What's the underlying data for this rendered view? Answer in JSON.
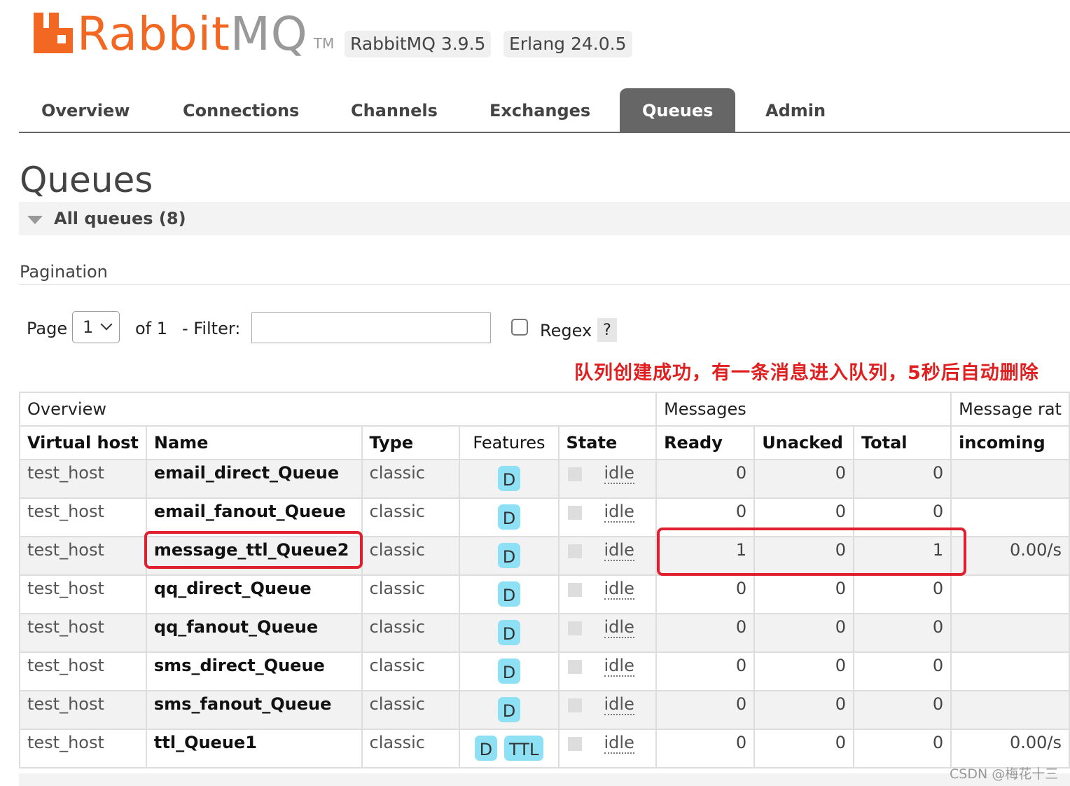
{
  "header": {
    "logo_brand": "Rabbit",
    "logo_suffix": "MQ",
    "logo_tm": "TM",
    "rabbitmq_version": "RabbitMQ 3.9.5",
    "erlang_version": "Erlang 24.0.5",
    "brand_color": "#f26822"
  },
  "nav": {
    "tabs": [
      "Overview",
      "Connections",
      "Channels",
      "Exchanges",
      "Queues",
      "Admin"
    ],
    "active": "Queues"
  },
  "page_title": "Queues",
  "section_label": "All queues (8)",
  "pagination": {
    "title": "Pagination",
    "page_label": "Page",
    "page_value": "1",
    "of_label": "of 1",
    "filter_label": "- Filter:",
    "filter_value": "",
    "regex_label": "Regex",
    "help_label": "?"
  },
  "annotation": "队列创建成功，有一条消息进入队列，5秒后自动删除",
  "table": {
    "groups": [
      "Overview",
      "Messages",
      "Message rat"
    ],
    "columns": [
      "Virtual host",
      "Name",
      "Type",
      "Features",
      "State",
      "Ready",
      "Unacked",
      "Total",
      "incoming"
    ],
    "rows": [
      {
        "vhost": "test_host",
        "name": "email_direct_Queue",
        "type": "classic",
        "features": [
          "D"
        ],
        "state": "idle",
        "ready": "0",
        "unacked": "0",
        "total": "0",
        "incoming": ""
      },
      {
        "vhost": "test_host",
        "name": "email_fanout_Queue",
        "type": "classic",
        "features": [
          "D"
        ],
        "state": "idle",
        "ready": "0",
        "unacked": "0",
        "total": "0",
        "incoming": ""
      },
      {
        "vhost": "test_host",
        "name": "message_ttl_Queue2",
        "type": "classic",
        "features": [
          "D"
        ],
        "state": "idle",
        "ready": "1",
        "unacked": "0",
        "total": "1",
        "incoming": "0.00/s"
      },
      {
        "vhost": "test_host",
        "name": "qq_direct_Queue",
        "type": "classic",
        "features": [
          "D"
        ],
        "state": "idle",
        "ready": "0",
        "unacked": "0",
        "total": "0",
        "incoming": ""
      },
      {
        "vhost": "test_host",
        "name": "qq_fanout_Queue",
        "type": "classic",
        "features": [
          "D"
        ],
        "state": "idle",
        "ready": "0",
        "unacked": "0",
        "total": "0",
        "incoming": ""
      },
      {
        "vhost": "test_host",
        "name": "sms_direct_Queue",
        "type": "classic",
        "features": [
          "D"
        ],
        "state": "idle",
        "ready": "0",
        "unacked": "0",
        "total": "0",
        "incoming": ""
      },
      {
        "vhost": "test_host",
        "name": "sms_fanout_Queue",
        "type": "classic",
        "features": [
          "D"
        ],
        "state": "idle",
        "ready": "0",
        "unacked": "0",
        "total": "0",
        "incoming": ""
      },
      {
        "vhost": "test_host",
        "name": "ttl_Queue1",
        "type": "classic",
        "features": [
          "D",
          "TTL"
        ],
        "state": "idle",
        "ready": "0",
        "unacked": "0",
        "total": "0",
        "incoming": "0.00/s"
      }
    ]
  },
  "watermark": "CSDN @梅花十三",
  "colors": {
    "highlight": "#e0202f",
    "badge": "#8ee0f5",
    "annotation": "#e02020"
  }
}
